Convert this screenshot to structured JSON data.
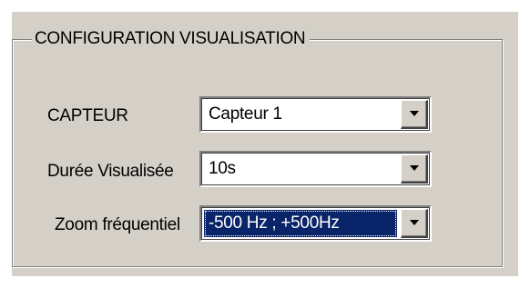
{
  "group": {
    "title": "CONFIGURATION VISUALISATION"
  },
  "fields": [
    {
      "label": "CAPTEUR",
      "value": "Capteur 1",
      "icon": "chevron-down-icon"
    },
    {
      "label": "Durée Visualisée",
      "value": "10s",
      "icon": "chevron-down-icon"
    },
    {
      "label": "Zoom fréquentiel",
      "value": "-500 Hz ; +500Hz",
      "icon": "chevron-down-icon"
    }
  ],
  "colors": {
    "panel": "#d4d0c8",
    "selection": "#0a246a"
  }
}
